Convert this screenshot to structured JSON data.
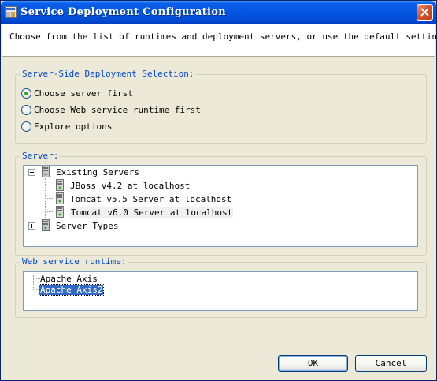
{
  "window": {
    "title": "Service Deployment Configuration"
  },
  "header": {
    "description": "Choose from the list of runtimes and deployment servers, or use the default settings."
  },
  "deployment_selection": {
    "legend": "Server-Side Deployment Selection:",
    "options": [
      {
        "label": "Choose server first",
        "checked": true
      },
      {
        "label": "Choose Web service runtime first",
        "checked": false
      },
      {
        "label": "Explore options",
        "checked": false
      }
    ]
  },
  "server": {
    "legend": "Server:",
    "tree": {
      "existing": {
        "label": "Existing Servers",
        "expanded": true,
        "children": [
          {
            "label": "JBoss v4.2 at localhost"
          },
          {
            "label": "Tomcat v5.5 Server at localhost"
          },
          {
            "label": "Tomcat v6.0 Server at localhost",
            "highlighted": true
          }
        ]
      },
      "types": {
        "label": "Server Types",
        "expanded": false
      }
    }
  },
  "runtime": {
    "legend": "Web service runtime:",
    "items": [
      {
        "label": "Apache Axis",
        "selected": false
      },
      {
        "label": "Apache Axis2",
        "selected": true
      }
    ]
  },
  "buttons": {
    "ok": "OK",
    "cancel": "Cancel"
  },
  "colors": {
    "title_bar": "#0255e0",
    "legend_text": "#0046d5",
    "selection": "#316ac5",
    "radio_dot": "#29a829",
    "dialog_bg": "#ece9d8"
  },
  "icons": {
    "title": "app-icon",
    "close": "close-icon",
    "server": "server-icon",
    "collapse": "minus-box-icon",
    "expand": "plus-box-icon"
  }
}
